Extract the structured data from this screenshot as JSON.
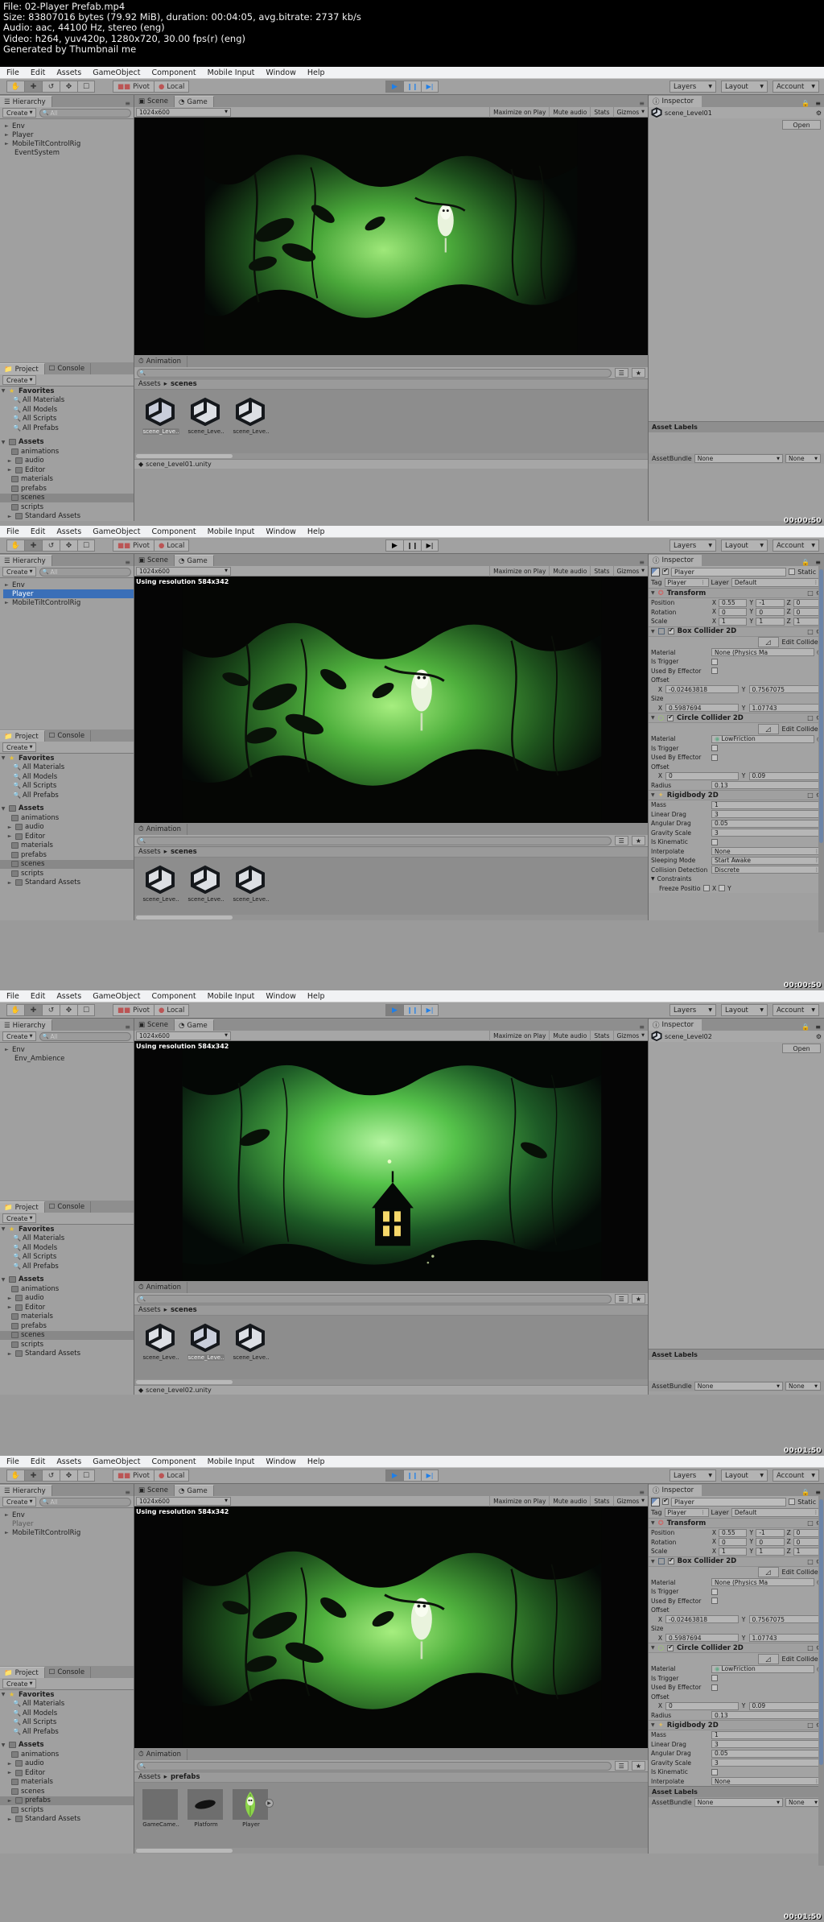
{
  "video_info": {
    "line1": "File: 02-Player Prefab.mp4",
    "line2": "Size: 83807016 bytes (79.92 MiB), duration: 00:04:05, avg.bitrate: 2737 kb/s",
    "line3": "Audio: aac, 44100 Hz, stereo (eng)",
    "line4": "Video: h264, yuv420p, 1280x720, 30.00 fps(r) (eng)",
    "line5": "Generated by Thumbnail me"
  },
  "menu": [
    "File",
    "Edit",
    "Assets",
    "GameObject",
    "Component",
    "Mobile Input",
    "Window",
    "Help"
  ],
  "toolbar": {
    "tools": [
      "hand-tool",
      "move-tool",
      "rotate-tool",
      "scale-tool",
      "rect-tool"
    ],
    "pivot": "Pivot",
    "local": "Local",
    "play": "▶",
    "pause": "❙❙",
    "step": "▶|",
    "layers": "Layers",
    "layout": "Layout",
    "account": "Account"
  },
  "hierarchy": {
    "tab": "Hierarchy",
    "create": "Create",
    "search_placeholder": "All",
    "panel1_items": [
      {
        "label": "Env",
        "expandable": true,
        "indent": 0,
        "selected": false
      },
      {
        "label": "Player",
        "expandable": true,
        "indent": 0,
        "selected": false
      },
      {
        "label": "MobileTiltControlRig",
        "expandable": true,
        "indent": 0,
        "selected": false
      },
      {
        "label": "EventSystem",
        "expandable": false,
        "indent": 1,
        "selected": false
      }
    ],
    "panel2_items": [
      {
        "label": "Env",
        "expandable": true,
        "indent": 0,
        "selected": false
      },
      {
        "label": "Player",
        "expandable": false,
        "indent": 0,
        "selected": true
      },
      {
        "label": "MobileTiltControlRig",
        "expandable": true,
        "indent": 0,
        "selected": false
      }
    ],
    "panel3_items": [
      {
        "label": "Env",
        "expandable": true,
        "indent": 0,
        "selected": false
      },
      {
        "label": "Env_Ambience",
        "expandable": false,
        "indent": 1,
        "selected": false
      }
    ],
    "panel4_items": [
      {
        "label": "Env",
        "expandable": true,
        "indent": 0,
        "selected": false
      },
      {
        "label": "Player",
        "expandable": false,
        "indent": 0,
        "selected": true
      },
      {
        "label": "MobileTiltControlRig",
        "expandable": true,
        "indent": 0,
        "selected": false
      }
    ]
  },
  "scene_view": {
    "scene_tab": "Scene",
    "game_tab": "Game",
    "resolution": "1024x600",
    "maximize_on_play": "Maximize on Play",
    "mute_audio": "Mute audio",
    "stats": "Stats",
    "gizmos": "Gizmos",
    "using_resolution": "Using resolution 584x342"
  },
  "project": {
    "project_tab": "Project",
    "console_tab": "Console",
    "animation_tab": "Animation",
    "create": "Create",
    "favorites": "Favorites",
    "favorite_items": [
      "All Materials",
      "All Models",
      "All Scripts",
      "All Prefabs"
    ],
    "assets_root": "Assets",
    "asset_folders_p1": [
      "animations",
      "audio",
      "Editor",
      "materials",
      "prefabs",
      "scenes",
      "scripts",
      "Standard Assets"
    ],
    "asset_folders_p2": [
      "animations",
      "audio",
      "Editor",
      "materials",
      "prefabs",
      "scenes",
      "scripts",
      "Standard Assets"
    ],
    "asset_folders_p3": [
      "animations",
      "audio",
      "Editor",
      "materials",
      "prefabs",
      "scenes",
      "scripts",
      "Standard Assets"
    ],
    "asset_folders_p4": [
      "animations",
      "audio",
      "Editor",
      "materials",
      "scenes",
      "prefabs",
      "scripts",
      "Standard Assets"
    ],
    "selected_folder_p1": "scenes",
    "selected_folder_p2": "scenes",
    "selected_folder_p3": "scenes",
    "selected_folder_p4": "prefabs"
  },
  "assets_browser": {
    "breadcrumb_root": "Assets",
    "breadcrumb_scenes": "scenes",
    "breadcrumb_prefabs": "prefabs",
    "scene_assets": [
      {
        "label": "scene_Leve..",
        "selected_p1": true,
        "selected_p3": false
      },
      {
        "label": "scene_Leve..",
        "selected_p1": false,
        "selected_p3": true
      },
      {
        "label": "scene_Leve..",
        "selected_p1": false,
        "selected_p3": false
      }
    ],
    "prefab_assets": [
      {
        "label": "GameCame..",
        "kind": "blank"
      },
      {
        "label": "Platform",
        "kind": "platform"
      },
      {
        "label": "Player",
        "kind": "player"
      }
    ]
  },
  "status_bar": {
    "panel1": "scene_Level01.unity",
    "panel3": "scene_Level02.unity"
  },
  "inspector": {
    "tab": "Inspector",
    "panel1_object": "scene_Level01",
    "panel1_open": "Open",
    "panel3_object": "scene_Level02",
    "panel3_open": "Open",
    "object_name": "Player",
    "static_label": "Static",
    "tag_label": "Tag",
    "tag_value": "Player",
    "layer_label": "Layer",
    "layer_value": "Default",
    "transform": {
      "title": "Transform",
      "rows": [
        {
          "label": "Position",
          "x": "0.55",
          "y": "-1",
          "z": "0"
        },
        {
          "label": "Rotation",
          "x": "0",
          "y": "0",
          "z": "0"
        },
        {
          "label": "Scale",
          "x": "1",
          "y": "1",
          "z": "1"
        }
      ]
    },
    "box_collider": {
      "title": "Box Collider 2D",
      "edit_collider": "Edit Collider",
      "material_label": "Material",
      "material_value": "None (Physics Ma",
      "is_trigger": "Is Trigger",
      "used_by_effector": "Used By Effector",
      "offset_label": "Offset",
      "offset_x": "-0.02463818",
      "offset_y": "0.7567075",
      "size_label": "Size",
      "size_x": "0.5987694",
      "size_y": "1.07743"
    },
    "circle_collider": {
      "title": "Circle Collider 2D",
      "edit_collider": "Edit Collider",
      "material_label": "Material",
      "material_value": "LowFriction",
      "is_trigger": "Is Trigger",
      "used_by_effector": "Used By Effector",
      "offset_label": "Offset",
      "offset_x": "0",
      "offset_y": "0.09",
      "radius_label": "Radius",
      "radius_value": "0.13"
    },
    "rigidbody": {
      "title": "Rigidbody 2D",
      "rows": [
        {
          "label": "Mass",
          "value": "1",
          "type": "text"
        },
        {
          "label": "Linear Drag",
          "value": "3",
          "type": "text"
        },
        {
          "label": "Angular Drag",
          "value": "0.05",
          "type": "text"
        },
        {
          "label": "Gravity Scale",
          "value": "3",
          "type": "text"
        },
        {
          "label": "Is Kinematic",
          "value": "",
          "type": "check"
        },
        {
          "label": "Interpolate",
          "value": "None",
          "type": "select"
        },
        {
          "label": "Sleeping Mode",
          "value": "Start Awake",
          "type": "select"
        },
        {
          "label": "Collision Detection",
          "value": "Discrete",
          "type": "select"
        }
      ],
      "constraints": "Constraints",
      "freeze_position": "Freeze Position",
      "freeze_x": "X",
      "freeze_y": "Y"
    },
    "asset_labels": "Asset Labels",
    "asset_bundle": "AssetBundle",
    "none": "None"
  },
  "timestamps": {
    "panel1": "00:00:50",
    "panel2": "00:00:50",
    "panel3": "00:01:50",
    "panel4": "00:01:50"
  },
  "colors": {
    "chrome": "#9a9a9a",
    "panel": "#a3a3a3",
    "selection": "#3a6fb8",
    "play_blue": "#1f7fe8",
    "forest_green": "#6fbf4a",
    "dark": "#0a0a0a"
  }
}
